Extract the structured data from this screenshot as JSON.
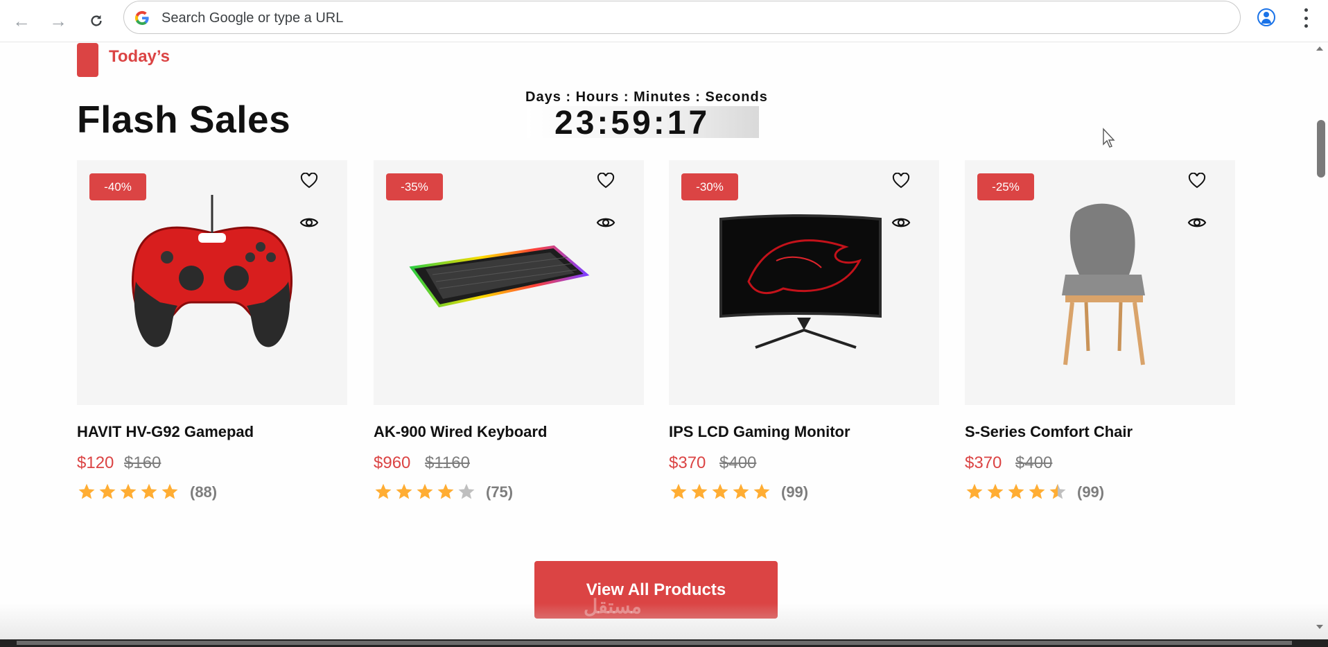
{
  "browser": {
    "omnibox_placeholder": "Search Google or type a URL"
  },
  "section": {
    "kicker": "Today’s",
    "title": "Flash Sales",
    "countdown_label": "Days : Hours : Minutes : Seconds",
    "countdown_value": "23:59:17"
  },
  "products": [
    {
      "discount": "-40%",
      "name": "HAVIT HV-G92 Gamepad",
      "price": "$120",
      "old_price": "$160",
      "rating": 5,
      "reviews": "(88)"
    },
    {
      "discount": "-35%",
      "name": "AK-900 Wired Keyboard",
      "price": "$960",
      "old_price": "$1160",
      "rating": 4,
      "reviews": "(75)"
    },
    {
      "discount": "-30%",
      "name": "IPS LCD Gaming Monitor",
      "price": "$370",
      "old_price": "$400",
      "rating": 5,
      "reviews": "(99)"
    },
    {
      "discount": "-25%",
      "name": "S-Series Comfort Chair",
      "price": "$370",
      "old_price": "$400",
      "rating": 4.5,
      "reviews": "(99)"
    }
  ],
  "cta": {
    "label": "View All Products"
  },
  "watermark": "مستقل",
  "colors": {
    "accent": "#db4444",
    "star": "#ffad33",
    "star_empty": "#bfbfbf"
  }
}
